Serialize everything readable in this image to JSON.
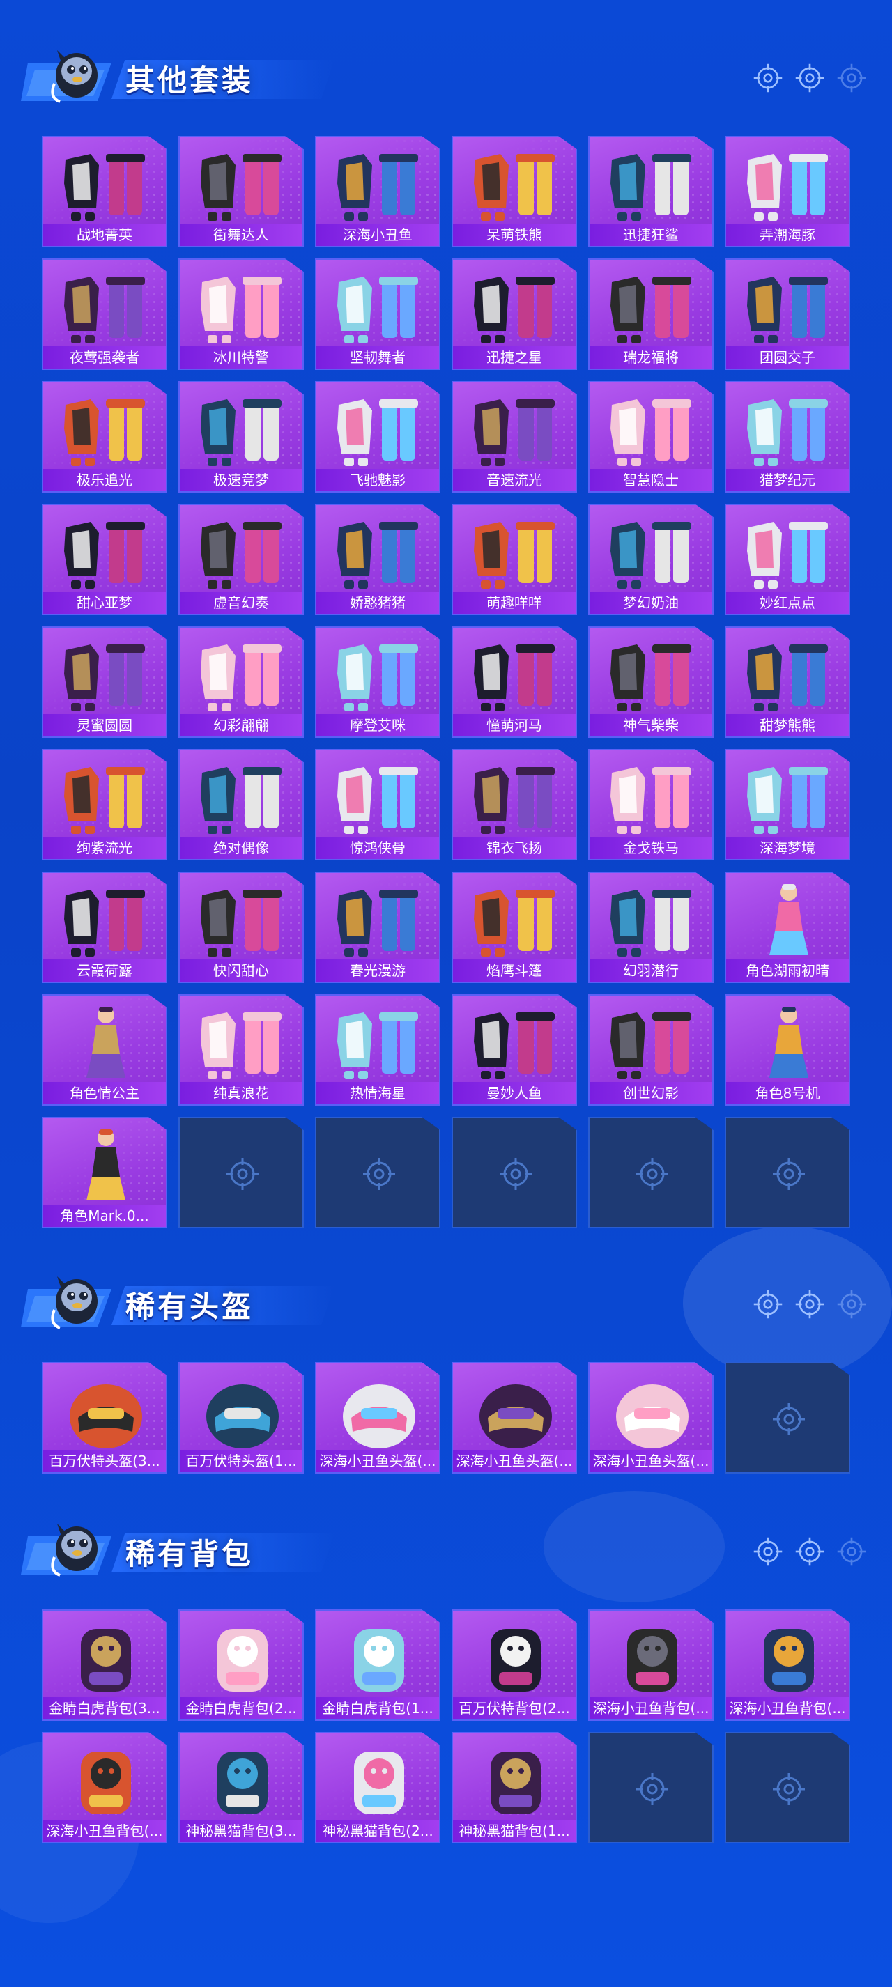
{
  "sections": [
    {
      "title": "其他套装",
      "items": [
        {
          "label": "战地菁英",
          "icon": "outfit-icon"
        },
        {
          "label": "街舞达人",
          "icon": "outfit-icon"
        },
        {
          "label": "深海小丑鱼",
          "icon": "outfit-icon"
        },
        {
          "label": "呆萌铁熊",
          "icon": "outfit-icon"
        },
        {
          "label": "迅捷狂鲨",
          "icon": "outfit-icon"
        },
        {
          "label": "弄潮海豚",
          "icon": "outfit-icon"
        },
        {
          "label": "夜莺强袭者",
          "icon": "outfit-icon"
        },
        {
          "label": "冰川特警",
          "icon": "outfit-icon"
        },
        {
          "label": "坚韧舞者",
          "icon": "outfit-icon"
        },
        {
          "label": "迅捷之星",
          "icon": "outfit-icon"
        },
        {
          "label": "瑞龙福将",
          "icon": "outfit-icon"
        },
        {
          "label": "团圆交子",
          "icon": "outfit-icon"
        },
        {
          "label": "极乐追光",
          "icon": "outfit-icon"
        },
        {
          "label": "极速竞梦",
          "icon": "outfit-icon"
        },
        {
          "label": "飞驰魅影",
          "icon": "outfit-icon"
        },
        {
          "label": "音速流光",
          "icon": "outfit-icon"
        },
        {
          "label": "智慧隐士",
          "icon": "outfit-icon"
        },
        {
          "label": "猎梦纪元",
          "icon": "outfit-icon"
        },
        {
          "label": "甜心亚梦",
          "icon": "outfit-icon"
        },
        {
          "label": "虚音幻奏",
          "icon": "outfit-icon"
        },
        {
          "label": "娇憨猪猪",
          "icon": "outfit-icon"
        },
        {
          "label": "萌趣咩咩",
          "icon": "outfit-icon"
        },
        {
          "label": "梦幻奶油",
          "icon": "outfit-icon"
        },
        {
          "label": "妙红点点",
          "icon": "outfit-icon"
        },
        {
          "label": "灵蜜圆圆",
          "icon": "outfit-icon"
        },
        {
          "label": "幻彩翩翩",
          "icon": "outfit-icon"
        },
        {
          "label": "摩登艾咪",
          "icon": "outfit-icon"
        },
        {
          "label": "憧萌河马",
          "icon": "outfit-icon"
        },
        {
          "label": "神气柴柴",
          "icon": "outfit-icon"
        },
        {
          "label": "甜梦熊熊",
          "icon": "outfit-icon"
        },
        {
          "label": "绚紫流光",
          "icon": "outfit-icon"
        },
        {
          "label": "绝对偶像",
          "icon": "outfit-icon"
        },
        {
          "label": "惊鸿侠骨",
          "icon": "outfit-icon"
        },
        {
          "label": "锦衣飞扬",
          "icon": "outfit-icon"
        },
        {
          "label": "金戈铁马",
          "icon": "outfit-icon"
        },
        {
          "label": "深海梦境",
          "icon": "outfit-icon"
        },
        {
          "label": "云霞荷露",
          "icon": "outfit-icon"
        },
        {
          "label": "快闪甜心",
          "icon": "outfit-icon"
        },
        {
          "label": "春光漫游",
          "icon": "outfit-icon"
        },
        {
          "label": "焰鹰斗篷",
          "icon": "outfit-icon"
        },
        {
          "label": "幻羽潜行",
          "icon": "outfit-icon"
        },
        {
          "label": "角色湖雨初晴",
          "icon": "character-icon"
        },
        {
          "label": "角色情公主",
          "icon": "character-icon"
        },
        {
          "label": "纯真浪花",
          "icon": "outfit-icon"
        },
        {
          "label": "热情海星",
          "icon": "outfit-icon"
        },
        {
          "label": "曼妙人鱼",
          "icon": "outfit-icon"
        },
        {
          "label": "创世幻影",
          "icon": "outfit-icon"
        },
        {
          "label": "角色8号机",
          "icon": "character-icon"
        },
        {
          "label": "角色Mark.0...",
          "icon": "character-icon"
        },
        null,
        null,
        null,
        null,
        null
      ]
    },
    {
      "title": "稀有头盔",
      "items": [
        {
          "label": "百万伏特头盔(3...",
          "icon": "helmet-icon"
        },
        {
          "label": "百万伏特头盔(1...",
          "icon": "helmet-icon"
        },
        {
          "label": "深海小丑鱼头盔(...",
          "icon": "helmet-icon"
        },
        {
          "label": "深海小丑鱼头盔(...",
          "icon": "helmet-icon"
        },
        {
          "label": "深海小丑鱼头盔(...",
          "icon": "helmet-icon"
        },
        null
      ]
    },
    {
      "title": "稀有背包",
      "items": [
        {
          "label": "金睛白虎背包(3...",
          "icon": "backpack-icon"
        },
        {
          "label": "金睛白虎背包(2...",
          "icon": "backpack-icon"
        },
        {
          "label": "金睛白虎背包(1...",
          "icon": "backpack-icon"
        },
        {
          "label": "百万伏特背包(2...",
          "icon": "backpack-icon"
        },
        {
          "label": "深海小丑鱼背包(...",
          "icon": "backpack-icon"
        },
        {
          "label": "深海小丑鱼背包(...",
          "icon": "backpack-icon"
        },
        {
          "label": "深海小丑鱼背包(...",
          "icon": "backpack-icon"
        },
        {
          "label": "神秘黑猫背包(3...",
          "icon": "backpack-icon"
        },
        {
          "label": "神秘黑猫背包(2...",
          "icon": "backpack-icon"
        },
        {
          "label": "神秘黑猫背包(1...",
          "icon": "backpack-icon"
        },
        null,
        null
      ]
    }
  ],
  "colors": {
    "background": "#0b49d6",
    "card": "#a046e8",
    "label_bar": "#8a2ee6",
    "empty_slot": "#1e3a74"
  }
}
